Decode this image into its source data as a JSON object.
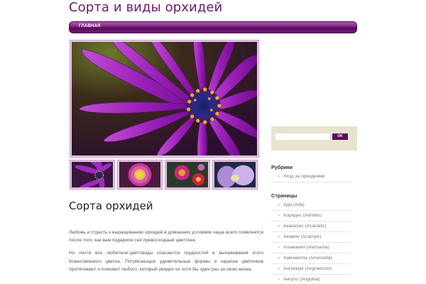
{
  "site": {
    "title": "Сорта и виды орхидей"
  },
  "nav": {
    "items": [
      {
        "label": "ГЛАВНАЯ"
      }
    ]
  },
  "gallery": {
    "main_alt": "purple daisy flower",
    "thumbnails": [
      "purple-daisy",
      "pink-dahlia",
      "red-flowers",
      "pale-purple-flower"
    ]
  },
  "post": {
    "title": "Сорта орхидей",
    "paragraphs": [
      "Любовь и страсть к выращиванию орхидей в домашних условиях чаще всего появляется после того, как вам подарили сей превосходный цветочек.",
      "Но почти все любители-цветоводы опасаются трудностей в выхаживания этого божественного цветка. Потрясающие удивительные формы и окраска цветочков притягивают и пленяют любого, который увидел их хотя бы один раз за свою жизнь."
    ]
  },
  "sidebar": {
    "search": {
      "placeholder": "",
      "button_label": "OK"
    },
    "rubrics": {
      "title": "Рубрики",
      "items": [
        "Уход за орхидеями"
      ]
    },
    "pages": {
      "title": "Страницы",
      "items": [
        "Ада (Ada)",
        "Аэридес (Aerides)",
        "Акакалис (Acacallis)",
        "Акампе (Acampe)",
        "Аламания (Alamania)",
        "Амезиелла (Amesiella)",
        "Ангрекум (Angraecum)",
        "Ангуло (Anguloa)"
      ]
    }
  },
  "colors": {
    "brand": "#6a1a6b",
    "nav_dark": "#5b0a5c",
    "search_bg": "#e8e3d0"
  }
}
